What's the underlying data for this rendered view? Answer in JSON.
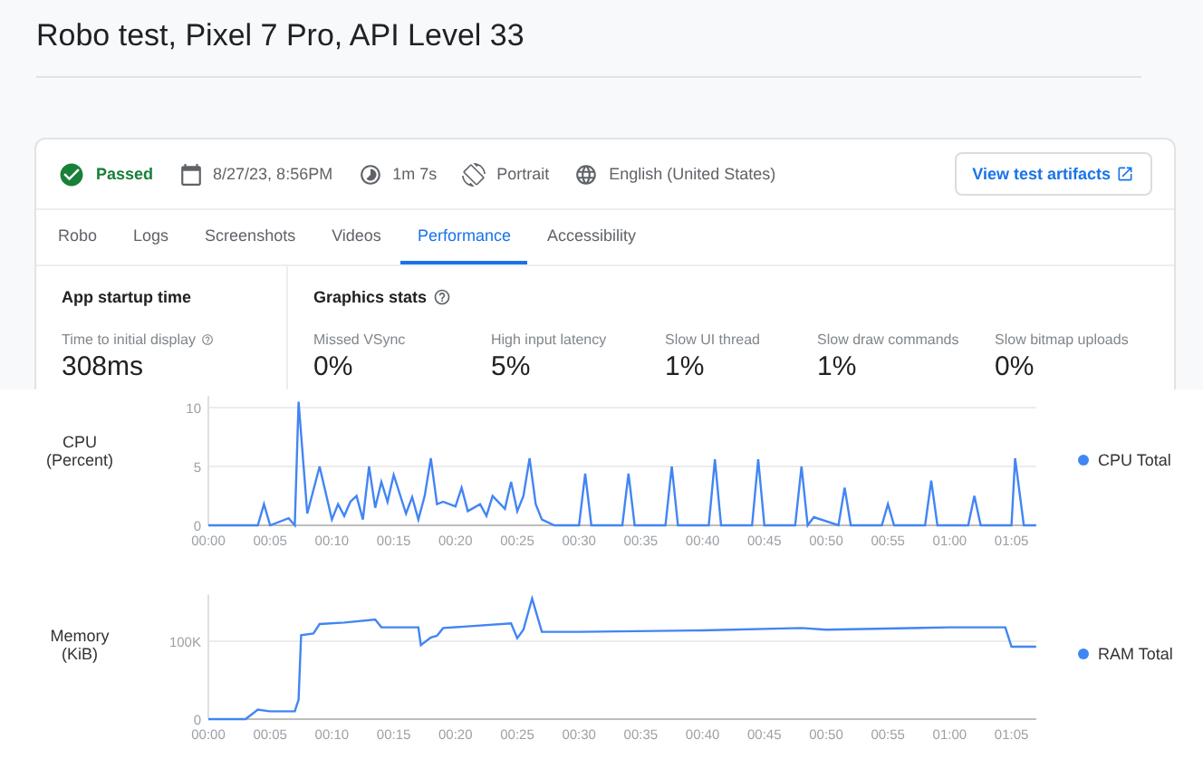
{
  "title": "Robo test, Pixel 7 Pro, API Level 33",
  "summary": {
    "status": {
      "label": "Passed",
      "passed": true
    },
    "items": [
      {
        "kind": "date",
        "text": "8/27/23, 8:56PM"
      },
      {
        "kind": "duration",
        "text": "1m 7s"
      },
      {
        "kind": "orientation",
        "text": "Portrait"
      },
      {
        "kind": "locale",
        "text": "English (United States)"
      }
    ],
    "button": "View test artifacts"
  },
  "tabs": [
    {
      "label": "Robo",
      "selected": false
    },
    {
      "label": "Logs",
      "selected": false
    },
    {
      "label": "Screenshots",
      "selected": false
    },
    {
      "label": "Videos",
      "selected": false
    },
    {
      "label": "Performance",
      "selected": true
    },
    {
      "label": "Accessibility",
      "selected": false
    }
  ],
  "startup": {
    "heading": "App startup time",
    "label": "Time to initial display",
    "value": "308ms"
  },
  "graphics": {
    "heading": "Graphics stats",
    "stats": [
      {
        "label": "Missed VSync",
        "value": "0%"
      },
      {
        "label": "High input latency",
        "value": "5%"
      },
      {
        "label": "Slow UI thread",
        "value": "1%"
      },
      {
        "label": "Slow draw commands",
        "value": "1%"
      },
      {
        "label": "Slow bitmap uploads",
        "value": "0%"
      }
    ]
  },
  "charts": [
    {
      "chart_data": {
        "type": "line",
        "ylabel": "CPU (Percent)",
        "xlim": [
          0,
          67
        ],
        "ylim": [
          0,
          11
        ],
        "yticks": [
          0,
          5,
          10
        ],
        "xticks": [
          {
            "value": 0,
            "label": "00:00"
          },
          {
            "value": 5,
            "label": "00:05"
          },
          {
            "value": 10,
            "label": "00:10"
          },
          {
            "value": 15,
            "label": "00:15"
          },
          {
            "value": 20,
            "label": "00:20"
          },
          {
            "value": 25,
            "label": "00:25"
          },
          {
            "value": 30,
            "label": "00:30"
          },
          {
            "value": 35,
            "label": "00:35"
          },
          {
            "value": 40,
            "label": "00:40"
          },
          {
            "value": 45,
            "label": "00:45"
          },
          {
            "value": 50,
            "label": "00:50"
          },
          {
            "value": 55,
            "label": "00:55"
          },
          {
            "value": 60,
            "label": "01:00"
          },
          {
            "value": 65,
            "label": "01:05"
          }
        ],
        "x": [
          0,
          4,
          4.5,
          5,
          6.5,
          7,
          7.3,
          8,
          9,
          10,
          10.5,
          11,
          11.5,
          12,
          12.5,
          13,
          13.5,
          14,
          14.5,
          15,
          16,
          16.5,
          17,
          17.5,
          18,
          18.5,
          19,
          20,
          20.5,
          21,
          22,
          22.5,
          23,
          24,
          24.5,
          25,
          25.5,
          26,
          26.5,
          27,
          28,
          30,
          30.5,
          31,
          33.5,
          34,
          34.5,
          37,
          37.5,
          38,
          40.5,
          41,
          41.5,
          44,
          44.5,
          45,
          47.5,
          48,
          48.5,
          49,
          51,
          51.5,
          52,
          54.5,
          55,
          55.5,
          58,
          58.5,
          59,
          61.5,
          62,
          62.5,
          65,
          65.3,
          66,
          67
        ],
        "series": [
          {
            "name": "CPU Total",
            "color": "#4285f4",
            "values": [
              0,
              0,
              1.8,
              0,
              0.6,
              0,
              10.5,
              1,
              5,
              0.5,
              1.8,
              0.8,
              2,
              2.5,
              0.5,
              5,
              1.5,
              3.7,
              2,
              4.3,
              1,
              2.4,
              0.5,
              2.5,
              5.7,
              1.8,
              2,
              1.6,
              3.2,
              1.2,
              1.8,
              0.8,
              2.5,
              1.4,
              3.7,
              1.2,
              2.5,
              5.7,
              1.8,
              0.5,
              0,
              0,
              4.4,
              0,
              0,
              4.4,
              0,
              0,
              5,
              0,
              0,
              5.6,
              0,
              0,
              5.6,
              0,
              0,
              5,
              0,
              0.7,
              0,
              3.2,
              0,
              0,
              1.8,
              0,
              0,
              3.8,
              0,
              0,
              2.5,
              0,
              0,
              5.7,
              0,
              0
            ]
          }
        ]
      }
    },
    {
      "chart_data": {
        "type": "line",
        "ylabel": "Memory (KiB)",
        "xlim": [
          0,
          67
        ],
        "ylim": [
          0,
          160000
        ],
        "yticks": [
          0,
          {
            "value": 100000,
            "label": "100K"
          }
        ],
        "xticks": [
          {
            "value": 0,
            "label": "00:00"
          },
          {
            "value": 5,
            "label": "00:05"
          },
          {
            "value": 10,
            "label": "00:10"
          },
          {
            "value": 15,
            "label": "00:15"
          },
          {
            "value": 20,
            "label": "00:20"
          },
          {
            "value": 25,
            "label": "00:25"
          },
          {
            "value": 30,
            "label": "00:30"
          },
          {
            "value": 35,
            "label": "00:35"
          },
          {
            "value": 40,
            "label": "00:40"
          },
          {
            "value": 45,
            "label": "00:45"
          },
          {
            "value": 50,
            "label": "00:50"
          },
          {
            "value": 55,
            "label": "00:55"
          },
          {
            "value": 60,
            "label": "01:00"
          },
          {
            "value": 65,
            "label": "01:05"
          }
        ],
        "x": [
          0,
          3,
          4,
          5,
          7,
          7.3,
          7.5,
          8.5,
          9,
          11,
          13.5,
          14,
          17,
          17.2,
          18,
          18.5,
          19,
          24.5,
          25,
          25.5,
          26.2,
          27,
          30,
          40,
          48,
          50,
          60,
          64.5,
          65,
          67
        ],
        "series": [
          {
            "name": "RAM Total",
            "color": "#4285f4",
            "values": [
              0,
              0,
              12000,
              10000,
              10000,
              25000,
              108000,
              110000,
              122000,
              124000,
              128000,
              118000,
              118000,
              95000,
              105000,
              107000,
              117000,
              123000,
              104000,
              115000,
              155000,
              112000,
              112000,
              114000,
              117000,
              115000,
              118000,
              118000,
              93000,
              93000
            ]
          }
        ]
      }
    }
  ]
}
